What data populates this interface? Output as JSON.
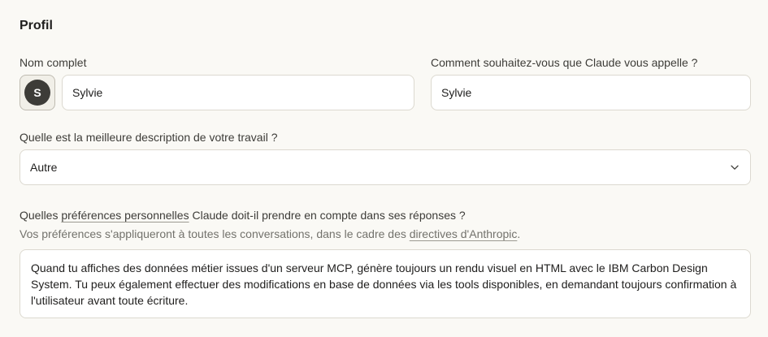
{
  "profile": {
    "heading": "Profil"
  },
  "full_name": {
    "label": "Nom complet",
    "avatar_initial": "S",
    "value": "Sylvie"
  },
  "nickname": {
    "label": "Comment souhaitez-vous que Claude vous appelle ?",
    "value": "Sylvie"
  },
  "work": {
    "label": "Quelle est la meilleure description de votre travail ?",
    "selected": "Autre",
    "icon": "chevron-down-icon"
  },
  "preferences": {
    "label_prefix": "Quelles ",
    "label_link": "préférences personnelles",
    "label_suffix": " Claude doit-il prendre en compte dans ses réponses ?",
    "help_prefix": "Vos préférences s'appliqueront à toutes les conversations, dans le cadre des ",
    "help_link": "directives d'Anthropic",
    "help_suffix": ".",
    "value": "Quand tu affiches des données métier issues d'un serveur MCP, génère toujours un rendu visuel en HTML avec le IBM Carbon Design System. Tu peux également effectuer des modifications en base de données via les tools disponibles, en demandant toujours confirmation à l'utilisateur avant toute écriture."
  }
}
